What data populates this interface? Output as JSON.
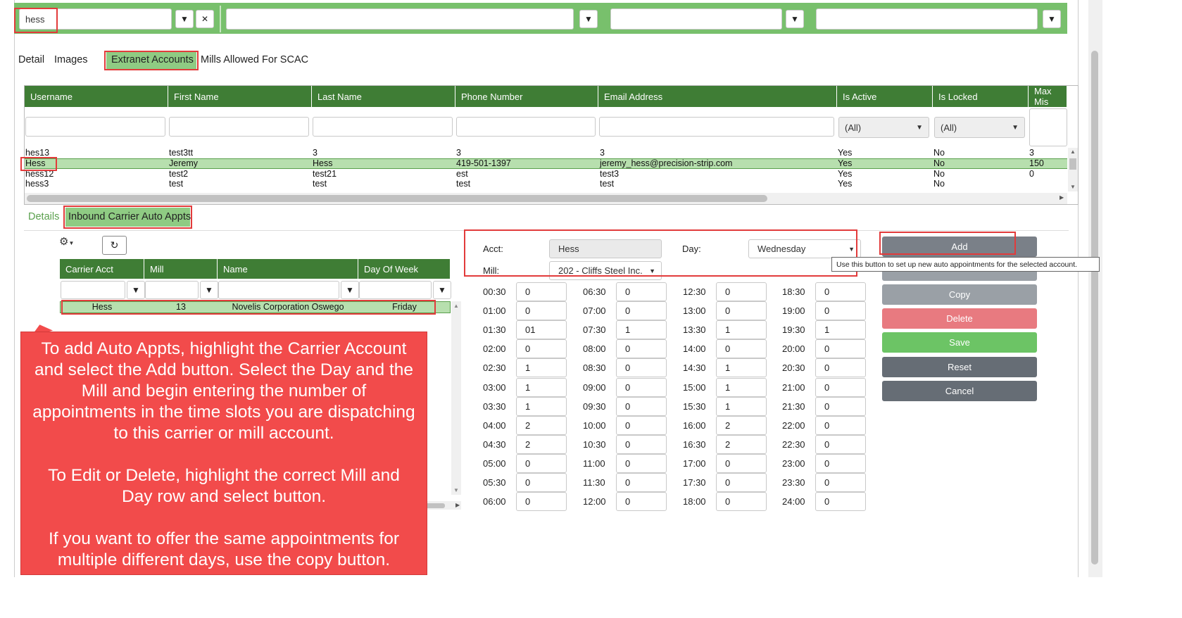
{
  "filters": {
    "username_value": "hess",
    "col2_value": "",
    "col3_value": "",
    "col4_value": ""
  },
  "top_tabs": [
    "Detail",
    "Images",
    "Extranet Accounts",
    "Mills Allowed For SCAC"
  ],
  "accounts_grid": {
    "columns": [
      "Username",
      "First Name",
      "Last Name",
      "Phone Number",
      "Email Address",
      "Is Active",
      "Is Locked",
      "Max Mis"
    ],
    "active_filter": "(All)",
    "locked_filter": "(All)",
    "rows": [
      {
        "username": "hes13",
        "first": "test3tt",
        "last": "3",
        "phone": "3",
        "email": "3",
        "active": "Yes",
        "locked": "No",
        "max": "3"
      },
      {
        "username": "Hess",
        "first": "Jeremy",
        "last": "Hess",
        "phone": "419-501-1397",
        "email": "jeremy_hess@precision-strip.com",
        "active": "Yes",
        "locked": "No",
        "max": "150"
      },
      {
        "username": "hess12",
        "first": "test2",
        "last": "test21",
        "phone": "est",
        "email": "test3",
        "active": "Yes",
        "locked": "No",
        "max": "0"
      },
      {
        "username": "hess3",
        "first": "test",
        "last": "test",
        "phone": "test",
        "email": "test",
        "active": "Yes",
        "locked": "No",
        "max": ""
      }
    ]
  },
  "sub_tabs": [
    "Details",
    "Inbound Carrier Auto Appts"
  ],
  "carrier_grid": {
    "columns": [
      "Carrier Acct",
      "Mill",
      "Name",
      "Day Of Week"
    ],
    "rows": [
      {
        "acct": "Hess",
        "mill": "13",
        "name": "Novelis Corporation Oswego",
        "day": "Friday"
      }
    ]
  },
  "form": {
    "acct_label": "Acct:",
    "acct_value": "Hess",
    "day_label": "Day:",
    "day_value": "Wednesday",
    "mill_label": "Mill:",
    "mill_value": "202 - Cliffs Steel Inc."
  },
  "slots": [
    {
      "time": "00:30",
      "value": "0"
    },
    {
      "time": "01:00",
      "value": "0"
    },
    {
      "time": "01:30",
      "value": "01"
    },
    {
      "time": "02:00",
      "value": "0"
    },
    {
      "time": "02:30",
      "value": "1"
    },
    {
      "time": "03:00",
      "value": "1"
    },
    {
      "time": "03:30",
      "value": "1"
    },
    {
      "time": "04:00",
      "value": "2"
    },
    {
      "time": "04:30",
      "value": "2"
    },
    {
      "time": "05:00",
      "value": "0"
    },
    {
      "time": "05:30",
      "value": "0"
    },
    {
      "time": "06:00",
      "value": "0"
    },
    {
      "time": "06:30",
      "value": "0"
    },
    {
      "time": "07:00",
      "value": "0"
    },
    {
      "time": "07:30",
      "value": "1"
    },
    {
      "time": "08:00",
      "value": "0"
    },
    {
      "time": "08:30",
      "value": "0"
    },
    {
      "time": "09:00",
      "value": "0"
    },
    {
      "time": "09:30",
      "value": "0"
    },
    {
      "time": "10:00",
      "value": "0"
    },
    {
      "time": "10:30",
      "value": "0"
    },
    {
      "time": "11:00",
      "value": "0"
    },
    {
      "time": "11:30",
      "value": "0"
    },
    {
      "time": "12:00",
      "value": "0"
    },
    {
      "time": "12:30",
      "value": "0"
    },
    {
      "time": "13:00",
      "value": "0"
    },
    {
      "time": "13:30",
      "value": "1"
    },
    {
      "time": "14:00",
      "value": "0"
    },
    {
      "time": "14:30",
      "value": "1"
    },
    {
      "time": "15:00",
      "value": "1"
    },
    {
      "time": "15:30",
      "value": "1"
    },
    {
      "time": "16:00",
      "value": "2"
    },
    {
      "time": "16:30",
      "value": "2"
    },
    {
      "time": "17:00",
      "value": "0"
    },
    {
      "time": "17:30",
      "value": "0"
    },
    {
      "time": "18:00",
      "value": "0"
    },
    {
      "time": "18:30",
      "value": "0"
    },
    {
      "time": "19:00",
      "value": "0"
    },
    {
      "time": "19:30",
      "value": "1"
    },
    {
      "time": "20:00",
      "value": "0"
    },
    {
      "time": "20:30",
      "value": "0"
    },
    {
      "time": "21:00",
      "value": "0"
    },
    {
      "time": "21:30",
      "value": "0"
    },
    {
      "time": "22:00",
      "value": "0"
    },
    {
      "time": "22:30",
      "value": "0"
    },
    {
      "time": "23:00",
      "value": "0"
    },
    {
      "time": "23:30",
      "value": "0"
    },
    {
      "time": "24:00",
      "value": "0"
    }
  ],
  "buttons": {
    "add": "Add",
    "copy": "Copy",
    "delete": "Delete",
    "save": "Save",
    "reset": "Reset",
    "cancel": "Cancel"
  },
  "tooltip": "Use this button to set up new auto appointments for the selected account.",
  "callout": {
    "p1": "To add Auto Appts, highlight the Carrier Account and select the Add button. Select the Day and the Mill and begin entering the number of appointments in the time slots you are dispatching to this carrier or mill account.",
    "p2": "To  Edit or Delete, highlight the correct Mill and Day row and select button.",
    "p3": "If you want to offer the same appointments for multiple different days, use the copy button."
  },
  "colors": {
    "header_green": "#3f7d35",
    "filter_green": "#78c06c",
    "highlight_green": "#b7dfae",
    "save_green": "#6cc465",
    "delete_red": "#e87a80",
    "reset_gray": "#666d75",
    "callout_red": "#f24b4b",
    "annotation_red": "#e23b3b"
  }
}
